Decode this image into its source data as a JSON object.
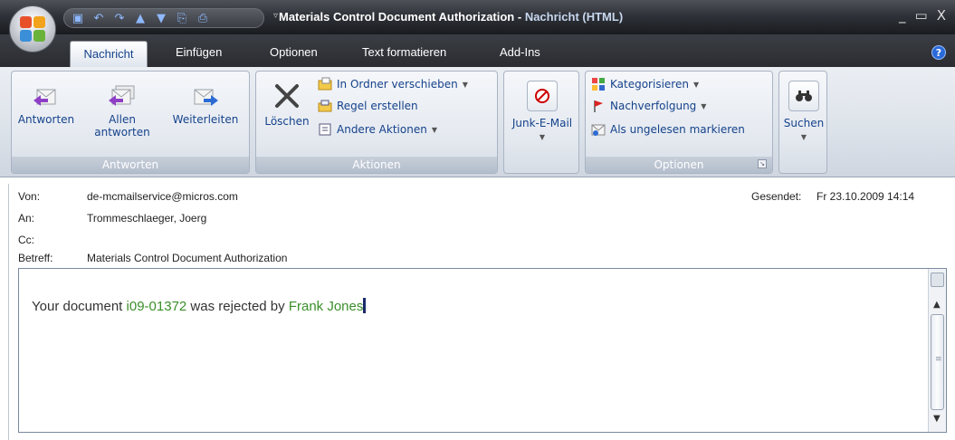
{
  "window": {
    "title_main": "Materials Control Document Authorization",
    "title_sep": " - ",
    "title_suffix": "Nachricht (HTML)",
    "controls": [
      "_",
      "▭",
      "X"
    ]
  },
  "quick_access": [
    "save-icon",
    "undo-icon",
    "redo-icon",
    "previous-item-icon",
    "next-item-icon",
    "copy-icon",
    "print-icon"
  ],
  "tabs": [
    {
      "label": "Nachricht",
      "active": true
    },
    {
      "label": "Einfügen"
    },
    {
      "label": "Optionen"
    },
    {
      "label": "Text formatieren"
    },
    {
      "label": "Add-Ins"
    }
  ],
  "ribbon": {
    "antworten": {
      "label": "Antworten",
      "reply": "Antworten",
      "reply_all_1": "Allen",
      "reply_all_2": "antworten",
      "forward": "Weiterleiten"
    },
    "aktionen": {
      "label": "Aktionen",
      "delete": "Löschen",
      "move": "In Ordner verschieben",
      "rule": "Regel erstellen",
      "other": "Andere Aktionen"
    },
    "junk": {
      "label": "Junk-E-Mail"
    },
    "optionen": {
      "label": "Optionen",
      "categorize": "Kategorisieren",
      "followup": "Nachverfolgung",
      "mark_unread": "Als ungelesen markieren"
    },
    "search": {
      "label": "Suchen"
    }
  },
  "header": {
    "from_label": "Von:",
    "from_value": "de-mcmailservice@micros.com",
    "to_label": "An:",
    "to_value": "Trommeschlaeger, Joerg",
    "cc_label": "Cc:",
    "cc_value": "",
    "subject_label": "Betreff:",
    "subject_value": "Materials Control Document Authorization",
    "sent_label": "Gesendet:",
    "sent_value": "Fr 23.10.2009 14:14"
  },
  "message": {
    "prefix": "Your document ",
    "doc_id": "i09-01372",
    "middle": " was rejected by ",
    "person": "Frank Jones"
  },
  "colors": {
    "accent_text": "#15428b",
    "link_green": "#3a8f2a",
    "title_bar": "#2f3238"
  }
}
